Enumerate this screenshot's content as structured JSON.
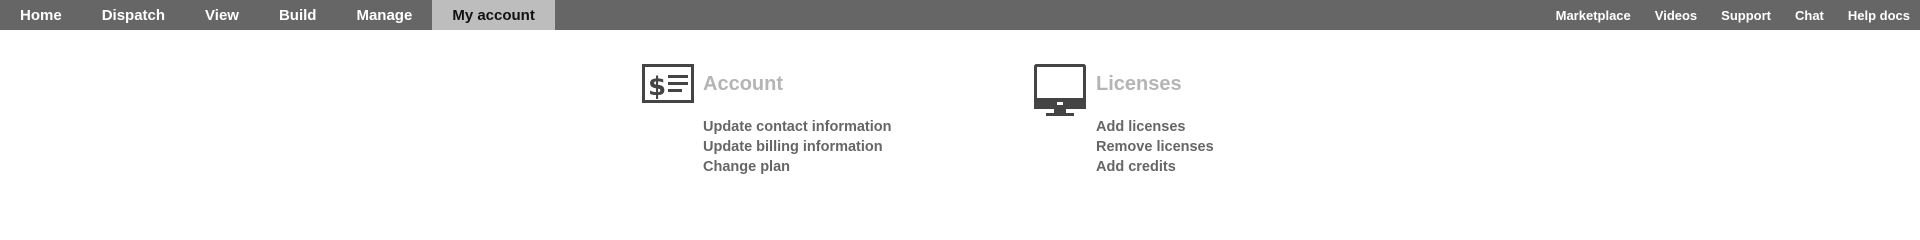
{
  "nav": {
    "tabs": [
      {
        "label": "Home",
        "active": false
      },
      {
        "label": "Dispatch",
        "active": false
      },
      {
        "label": "View",
        "active": false
      },
      {
        "label": "Build",
        "active": false
      },
      {
        "label": "Manage",
        "active": false
      },
      {
        "label": "My account",
        "active": true
      }
    ],
    "links": [
      {
        "label": "Marketplace"
      },
      {
        "label": "Videos"
      },
      {
        "label": "Support"
      },
      {
        "label": "Chat"
      },
      {
        "label": "Help docs"
      }
    ]
  },
  "sections": {
    "account": {
      "icon": "billing-check-icon",
      "title": "Account",
      "links": [
        "Update contact information",
        "Update billing information",
        "Change plan"
      ]
    },
    "licenses": {
      "icon": "monitor-icon",
      "title": "Licenses",
      "links": [
        "Add licenses",
        "Remove licenses",
        "Add credits"
      ]
    }
  },
  "colors": {
    "topbar": "#666666",
    "active_tab": "#bdbdbd",
    "section_title": "#b5b5b5",
    "link_text": "#666666",
    "icon": "#444444"
  }
}
